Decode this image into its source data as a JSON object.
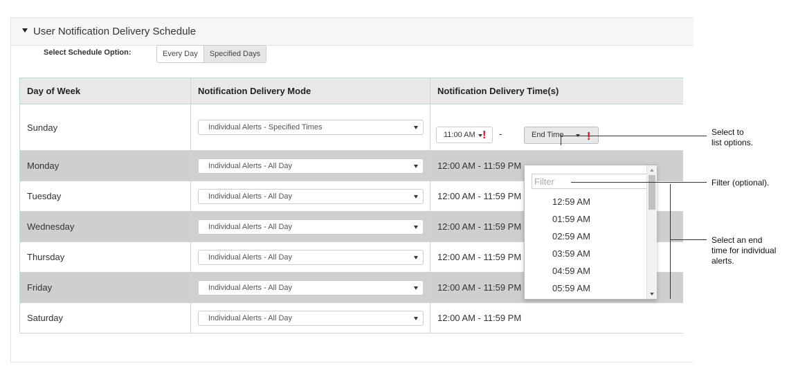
{
  "panel": {
    "title": "User Notification Delivery Schedule"
  },
  "schedule_option": {
    "label": "Select Schedule Option:",
    "options": [
      "Every Day",
      "Specified Days"
    ],
    "selected": "Specified Days"
  },
  "table": {
    "headers": [
      "Day of Week",
      "Notification Delivery Mode",
      "Notification Delivery Time(s)"
    ],
    "rows": [
      {
        "day": "Sunday",
        "mode": "Individual Alerts - Specified Times",
        "time": ""
      },
      {
        "day": "Monday",
        "mode": "Individual Alerts - All Day",
        "time": "12:00 AM - 11:59 PM"
      },
      {
        "day": "Tuesday",
        "mode": "Individual Alerts - All Day",
        "time": "12:00 AM - 11:59 PM"
      },
      {
        "day": "Wednesday",
        "mode": "Individual Alerts - All Day",
        "time": "12:00 AM - 11:59 PM"
      },
      {
        "day": "Thursday",
        "mode": "Individual Alerts - All Day",
        "time": "12:00 AM - 11:59 PM"
      },
      {
        "day": "Friday",
        "mode": "Individual Alerts - All Day",
        "time": "12:00 AM - 11:59 PM"
      },
      {
        "day": "Saturday",
        "mode": "Individual Alerts - All Day",
        "time": "12:00 AM - 11:59 PM"
      }
    ]
  },
  "sunday_times": {
    "start": "11:00 AM",
    "separator": "-",
    "end_button": "End Time",
    "required_mark": "!"
  },
  "end_time_dropdown": {
    "filter_placeholder": "Filter",
    "options": [
      "12:59 AM",
      "01:59 AM",
      "02:59 AM",
      "03:59 AM",
      "04:59 AM",
      "05:59 AM"
    ]
  },
  "callouts": {
    "select_list": "Select to\nlist options.",
    "filter": "Filter (optional).",
    "end_time": "Select an end\ntime for individual\nalerts."
  },
  "colors": {
    "shaded_row": "#cfcfcf",
    "header_bg": "#e8e8e8",
    "required": "#e00000"
  }
}
